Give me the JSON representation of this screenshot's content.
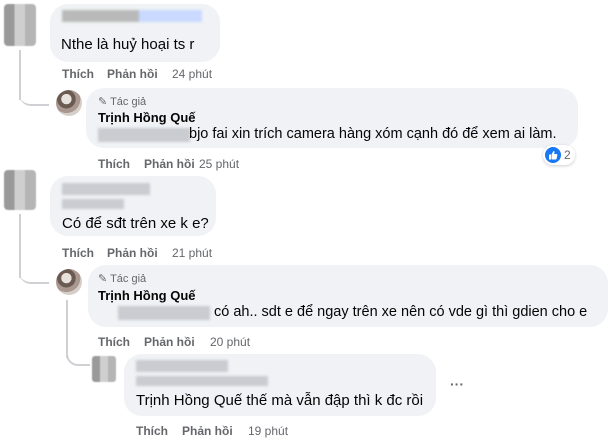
{
  "actions": {
    "like": "Thích",
    "reply": "Phản hồi"
  },
  "comments": [
    {
      "text": "Nthe là huỷ hoại ts r",
      "time": "24 phút"
    },
    {
      "badge": "Tác giả",
      "author": "Trịnh Hồng Quế",
      "text": "bjo fai xin trích camera hàng xóm cạnh đó để xem ai làm.",
      "time": "25 phút",
      "reaction_count": "2"
    },
    {
      "text": "Có để sđt trên xe k e?",
      "time": "21 phút"
    },
    {
      "badge": "Tác giả",
      "author": "Trịnh Hồng Quế",
      "text_a": "có ah.. sdt e để ngay trên xe nên có vde gì thì gdien cho e",
      "time": "20 phút"
    },
    {
      "text": "Trịnh Hồng Quế thế mà vẫn đập thì k đc rồi",
      "time": "19 phút"
    }
  ],
  "more_options": "···"
}
